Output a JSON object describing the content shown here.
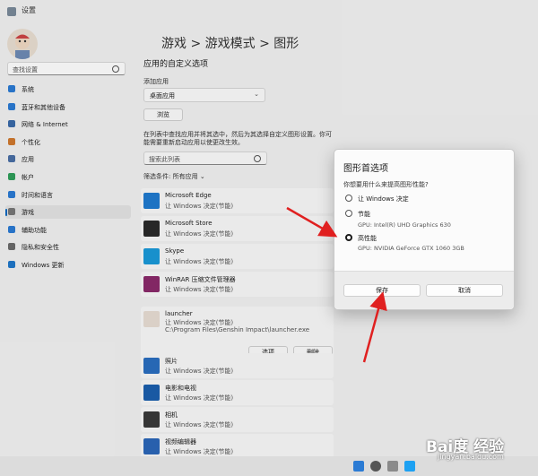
{
  "window": {
    "title": "设置"
  },
  "sidebar": {
    "search_placeholder": "查找设置",
    "items": [
      {
        "label": "系统",
        "icon": "display-icon",
        "color": "#2b7bd4"
      },
      {
        "label": "蓝牙和其他设备",
        "icon": "bluetooth-icon",
        "color": "#2b7bd4"
      },
      {
        "label": "网络 & Internet",
        "icon": "wifi-icon",
        "color": "#3a6aa8"
      },
      {
        "label": "个性化",
        "icon": "brush-icon",
        "color": "#d0792e"
      },
      {
        "label": "应用",
        "icon": "apps-icon",
        "color": "#4a6fa5"
      },
      {
        "label": "帐户",
        "icon": "account-icon",
        "color": "#2f9e5a"
      },
      {
        "label": "时间和语言",
        "icon": "clock-globe-icon",
        "color": "#2b7bd4"
      },
      {
        "label": "游戏",
        "icon": "gamepad-icon",
        "color": "#777777"
      },
      {
        "label": "辅助功能",
        "icon": "accessibility-icon",
        "color": "#2b7bd4"
      },
      {
        "label": "隐私和安全性",
        "icon": "shield-icon",
        "color": "#6b6b6b"
      },
      {
        "label": "Windows 更新",
        "icon": "update-icon",
        "color": "#1f77c9"
      }
    ],
    "selected_index": 7
  },
  "main": {
    "breadcrumb": "游戏  >  游戏模式  >  图形",
    "section_title": "应用的自定义选项",
    "add_app_label": "添加应用",
    "dropdown_value": "桌面应用",
    "browse_button": "浏览",
    "description": "在列表中查找应用并将其选中，然后为其选择自定义图形设置。你可能需要重新启动应用以使更改生效。",
    "list_search_placeholder": "搜索此列表",
    "filter_label": "筛选条件: 所有应用",
    "apps": [
      {
        "name": "Microsoft Edge",
        "sub": "让 Windows 决定(节能)",
        "icon": "edge-icon",
        "color": "#1f7bd0"
      },
      {
        "name": "Microsoft Store",
        "sub": "让 Windows 决定(节能)",
        "icon": "store-icon",
        "color": "#2a2a2a"
      },
      {
        "name": "Skype",
        "sub": "让 Windows 决定(节能)",
        "icon": "skype-icon",
        "color": "#1a9ad9"
      },
      {
        "name": "WinRAR 压缩文件管理器",
        "sub": "让 Windows 决定(节能)",
        "icon": "winrar-icon",
        "color": "#8b2a6b"
      }
    ],
    "launcher": {
      "name": "launcher",
      "sub": "让 Windows 决定(节能)",
      "path": "C:\\Program Files\\Genshin Impact\\launcher.exe",
      "options_button": "选项",
      "delete_button": "删除"
    },
    "apps2": [
      {
        "name": "照片",
        "sub": "让 Windows 决定(节能)",
        "icon": "photos-icon",
        "color": "#2a6ec0"
      },
      {
        "name": "电影和电视",
        "sub": "让 Windows 决定(节能)",
        "icon": "movies-icon",
        "color": "#1b5fae"
      },
      {
        "name": "相机",
        "sub": "让 Windows 决定(节能)",
        "icon": "camera-icon",
        "color": "#3a3a3a"
      },
      {
        "name": "视频编辑器",
        "sub": "让 Windows 决定(节能)",
        "icon": "video-editor-icon",
        "color": "#2b66b8"
      }
    ]
  },
  "dialog": {
    "title": "图形首选项",
    "question": "你想要用什么来提高图形性能?",
    "options": [
      {
        "label": "让 Windows 决定",
        "sub": ""
      },
      {
        "label": "节能",
        "sub": "GPU: Intel(R) UHD Graphics 630"
      },
      {
        "label": "高性能",
        "sub": "GPU: NVIDIA GeForce GTX 1060 3GB"
      }
    ],
    "selected_index": 2,
    "save_button": "保存",
    "cancel_button": "取消"
  },
  "watermark": {
    "main": "Bai度 经验",
    "sub": "jingyan.baidu.com"
  },
  "colors": {
    "accent": "#0067c0",
    "arrow": "#e02020"
  }
}
